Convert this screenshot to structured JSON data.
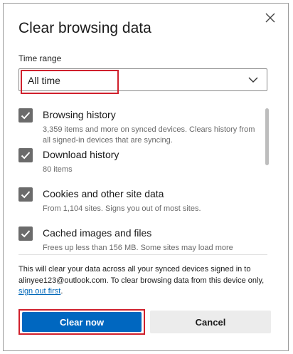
{
  "dialog": {
    "title": "Clear browsing data",
    "time_range_label": "Time range",
    "time_range_value": "All time"
  },
  "items": [
    {
      "label": "Browsing history",
      "description": "3,359 items and more on synced devices. Clears history from all signed-in devices that are syncing.",
      "checked": true
    },
    {
      "label": "Download history",
      "description": "80 items",
      "checked": true
    },
    {
      "label": "Cookies and other site data",
      "description": "From 1,104 sites. Signs you out of most sites.",
      "checked": true
    },
    {
      "label": "Cached images and files",
      "description": "Frees up less than 156 MB. Some sites may load more",
      "checked": true
    }
  ],
  "notice": {
    "text_before": "This will clear your data across all your synced devices signed in to alinyee123@outlook.com. To clear browsing data from this device only, ",
    "link": "sign out first",
    "text_after": "."
  },
  "buttons": {
    "clear": "Clear now",
    "cancel": "Cancel"
  },
  "colors": {
    "accent": "#0067c0",
    "highlight": "#d0202c",
    "checkbox": "#6b6b6b"
  }
}
